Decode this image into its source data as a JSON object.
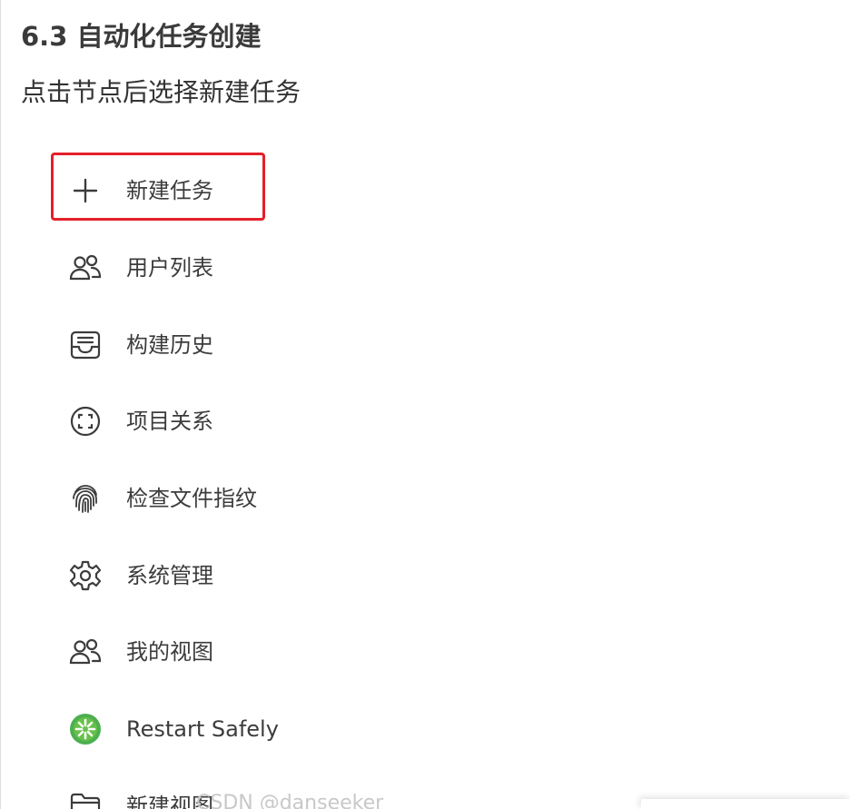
{
  "section": {
    "title": "6.3 自动化任务创建",
    "description": "点击节点后选择新建任务"
  },
  "menu": {
    "items": [
      {
        "label": "新建任务",
        "icon": "plus-icon"
      },
      {
        "label": "用户列表",
        "icon": "users-icon"
      },
      {
        "label": "构建历史",
        "icon": "inbox-icon"
      },
      {
        "label": "项目关系",
        "icon": "focus-circle-icon"
      },
      {
        "label": "检查文件指纹",
        "icon": "fingerprint-icon"
      },
      {
        "label": "系统管理",
        "icon": "gear-icon"
      },
      {
        "label": "我的视图",
        "icon": "users-icon"
      },
      {
        "label": "Restart Safely",
        "icon": "restart-safely-icon"
      },
      {
        "label": "新建视图",
        "icon": "folder-icon"
      }
    ]
  },
  "watermark": {
    "text": "CSDN @danseeker"
  },
  "colors": {
    "highlight": "#e4202a",
    "restart_icon": "#4caf50"
  }
}
